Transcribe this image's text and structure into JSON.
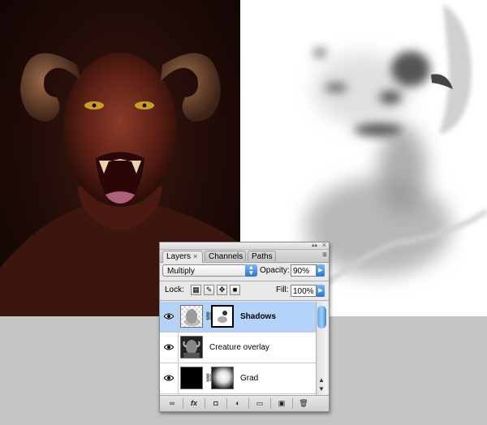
{
  "panel": {
    "tabs": [
      {
        "label": "Layers",
        "close": "×",
        "active": true
      },
      {
        "label": "Channels",
        "active": false
      },
      {
        "label": "Paths",
        "active": false
      }
    ],
    "panel_menu_glyph": "≡",
    "close_glyph": "×",
    "collapse_glyph": "▴▴"
  },
  "controls": {
    "blend_mode": "Multiply",
    "opacity_label": "Opacity:",
    "opacity_value": "90%",
    "lock_label": "Lock:",
    "fill_label": "Fill:",
    "fill_value": "100%"
  },
  "layers": [
    {
      "name": "Shadows",
      "selected": true,
      "visible": true,
      "has_mask": true
    },
    {
      "name": "Creature overlay",
      "selected": false,
      "visible": true,
      "has_mask": false
    },
    {
      "name": "Grad",
      "selected": false,
      "visible": true,
      "has_mask": true
    }
  ],
  "bottom_toolbar": [
    {
      "icon": "link-layers-icon",
      "glyph": "∞"
    },
    {
      "icon": "layer-style-icon",
      "glyph": "fx"
    },
    {
      "icon": "add-mask-icon",
      "glyph": "◘"
    },
    {
      "icon": "adjustment-layer-icon",
      "glyph": "◐"
    },
    {
      "icon": "new-group-icon",
      "glyph": "▭"
    },
    {
      "icon": "new-layer-icon",
      "glyph": "▣"
    },
    {
      "icon": "delete-layer-icon",
      "glyph": "🗑"
    }
  ],
  "colors": {
    "selection": "#b4d3fb",
    "accent_blue": "#2a73d8"
  }
}
